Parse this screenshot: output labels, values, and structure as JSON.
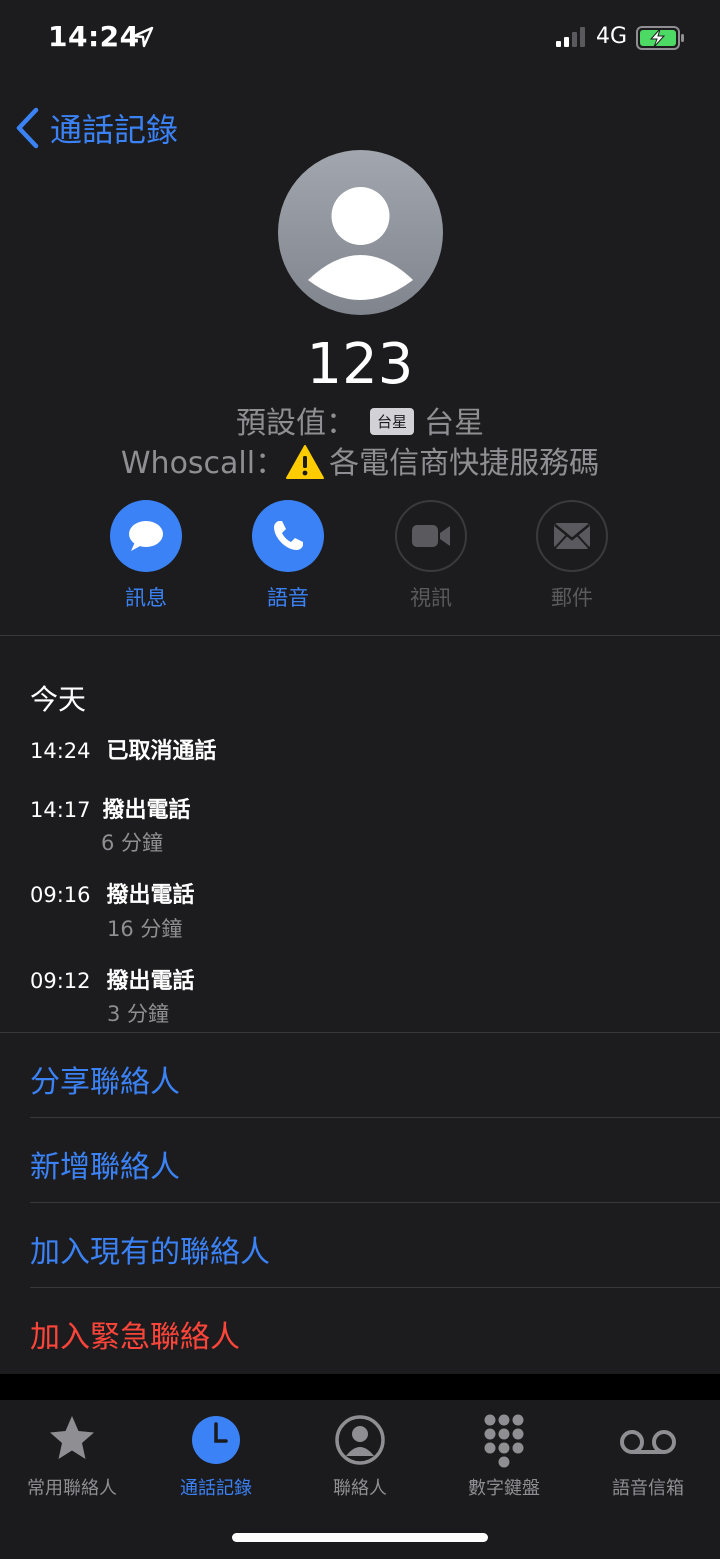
{
  "status": {
    "time": "14:24",
    "network": "4G",
    "battery_color": "#4cd964"
  },
  "nav": {
    "back_label": "通話記錄"
  },
  "contact": {
    "name": "123",
    "carrier_prefix": "預設值：",
    "carrier_badge": "台星",
    "carrier_name": "台星",
    "whoscall_prefix": "Whoscall：",
    "whoscall_text": "各電信商快捷服務碼"
  },
  "actions": [
    {
      "label": "訊息",
      "icon": "message-icon",
      "enabled": true
    },
    {
      "label": "語音",
      "icon": "phone-icon",
      "enabled": true
    },
    {
      "label": "視訊",
      "icon": "video-icon",
      "enabled": false
    },
    {
      "label": "郵件",
      "icon": "mail-icon",
      "enabled": false
    }
  ],
  "recents": {
    "day": "今天",
    "calls": [
      {
        "time": "14:24",
        "type": "已取消通話",
        "duration": ""
      },
      {
        "time": "14:17",
        "type": "撥出電話",
        "duration": "6 分鐘"
      },
      {
        "time": "09:16",
        "type": "撥出電話",
        "duration": "16 分鐘"
      },
      {
        "time": "09:12",
        "type": "撥出電話",
        "duration": "3 分鐘"
      }
    ]
  },
  "menu": {
    "share": "分享聯絡人",
    "new": "新增聯絡人",
    "add_existing": "加入現有的聯絡人",
    "emergency": "加入緊急聯絡人"
  },
  "tabs": [
    {
      "label": "常用聯絡人",
      "icon": "star-icon",
      "active": false
    },
    {
      "label": "通話記錄",
      "icon": "clock-icon",
      "active": true
    },
    {
      "label": "聯絡人",
      "icon": "person-circle-icon",
      "active": false
    },
    {
      "label": "數字鍵盤",
      "icon": "keypad-icon",
      "active": false
    },
    {
      "label": "語音信箱",
      "icon": "voicemail-icon",
      "active": false
    }
  ],
  "colors": {
    "accent": "#3b82f6",
    "destructive": "#ff453a",
    "background": "#1c1c1e"
  }
}
